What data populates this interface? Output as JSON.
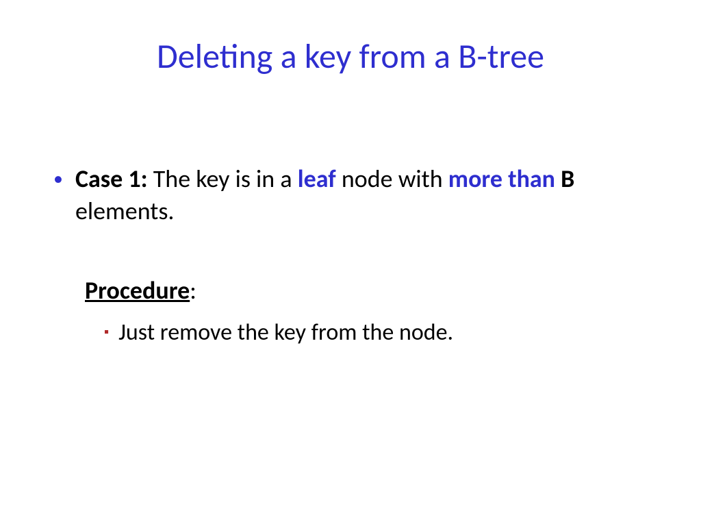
{
  "title": "Deleting a key from a B-tree",
  "case": {
    "label": "Case 1:",
    "pre": "  The key is in a ",
    "hl1": "leaf",
    "mid": " node with ",
    "hl2": "more than",
    "sp": " ",
    "hl3": "B",
    "post": " elements."
  },
  "procedure": {
    "label": "Procedure",
    "colon": ":",
    "item": "Just remove the key from the node."
  }
}
